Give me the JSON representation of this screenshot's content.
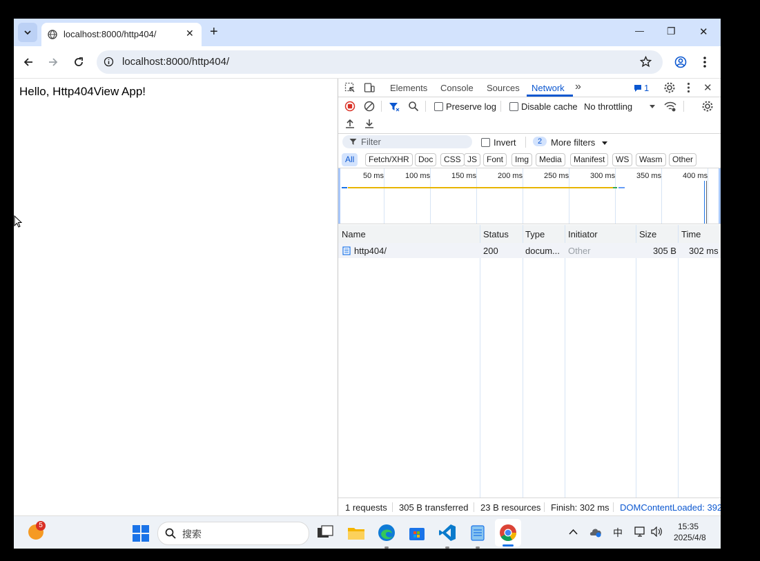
{
  "browser": {
    "tab_title": "localhost:8000/http404/",
    "url": "localhost:8000/http404/",
    "new_tab_glyph": "+",
    "window_controls": {
      "minimize": "—",
      "restore": "❐",
      "close": "✕"
    },
    "icons": [
      "tab-search-icon",
      "globe-icon",
      "close-icon",
      "plus-icon",
      "back-icon",
      "forward-icon",
      "reload-icon",
      "site-info-icon",
      "star-icon",
      "profile-icon",
      "menu-icon"
    ]
  },
  "page": {
    "text": "Hello, Http404View App!"
  },
  "devtools": {
    "tabs": [
      "Elements",
      "Console",
      "Sources",
      "Network"
    ],
    "active_tab": "Network",
    "issues_count": "1",
    "toolbar": {
      "preserve_log": "Preserve log",
      "disable_cache": "Disable cache",
      "throttling": "No throttling"
    },
    "filter": {
      "placeholder": "Filter",
      "invert": "Invert",
      "more_filters_count": "2",
      "more_filters": "More filters"
    },
    "type_filters": [
      "All",
      "Fetch/XHR",
      "Doc",
      "CSS",
      "JS",
      "Font",
      "Img",
      "Media",
      "Manifest",
      "WS",
      "Wasm",
      "Other"
    ],
    "timeline_ticks": [
      "50 ms",
      "100 ms",
      "150 ms",
      "200 ms",
      "250 ms",
      "300 ms",
      "350 ms",
      "400 ms"
    ],
    "columns": [
      "Name",
      "Status",
      "Type",
      "Initiator",
      "Size",
      "Time"
    ],
    "rows": [
      {
        "name": "http404/",
        "status": "200",
        "type": "docum...",
        "initiator": "Other",
        "size": "305 B",
        "time": "302 ms"
      }
    ],
    "status_bar": {
      "requests": "1 requests",
      "transferred": "305 B transferred",
      "resources": "23 B resources",
      "finish": "Finish: 302 ms",
      "dcl": "DOMContentLoaded: 392"
    },
    "colors": {
      "accent": "#0b57d0",
      "record": "#d93025",
      "waterfall": "#e8b400"
    }
  },
  "taskbar": {
    "badge": "5",
    "search_placeholder": "搜索",
    "ime": "中",
    "time": "15:35",
    "date": "2025/4/8"
  }
}
